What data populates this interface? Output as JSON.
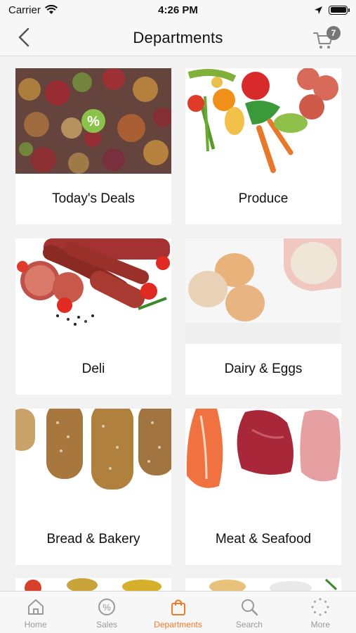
{
  "status": {
    "carrier": "Carrier",
    "time": "4:26 PM"
  },
  "nav": {
    "title": "Departments",
    "cart_count": "7"
  },
  "departments": [
    {
      "label": "Today's Deals",
      "image": "mixed-vegetables-deal"
    },
    {
      "label": "Produce",
      "image": "vegetables"
    },
    {
      "label": "Deli",
      "image": "sausages"
    },
    {
      "label": "Dairy & Eggs",
      "image": "eggs-and-milk"
    },
    {
      "label": "Bread & Bakery",
      "image": "bread-loaves"
    },
    {
      "label": "Meat & Seafood",
      "image": "meat-and-fish"
    }
  ],
  "tabs": [
    {
      "label": "Home",
      "icon": "home-icon",
      "active": false
    },
    {
      "label": "Sales",
      "icon": "sales-icon",
      "active": false
    },
    {
      "label": "Departments",
      "icon": "bag-icon",
      "active": true
    },
    {
      "label": "Search",
      "icon": "search-icon",
      "active": false
    },
    {
      "label": "More",
      "icon": "more-icon",
      "active": false
    }
  ],
  "colors": {
    "accent": "#f07a2a",
    "inactive": "#999999",
    "deal_badge": "#8bc34a"
  }
}
